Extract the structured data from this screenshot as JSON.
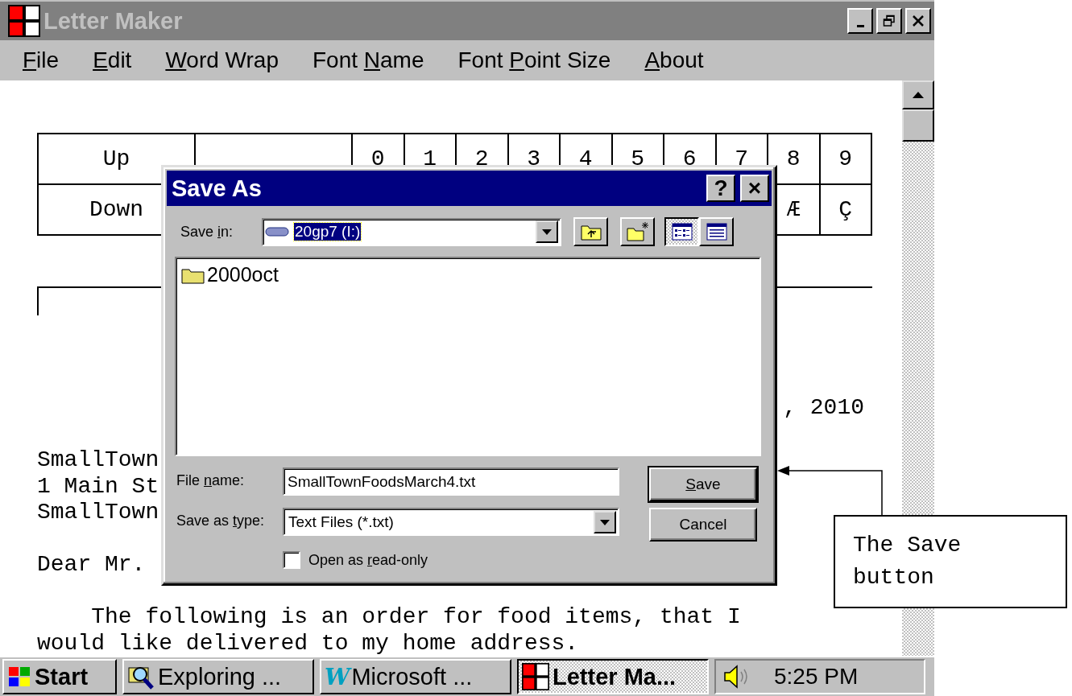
{
  "window": {
    "title": "Letter Maker",
    "active": false
  },
  "menu": [
    {
      "key": "F",
      "post": "ile"
    },
    {
      "key": "E",
      "post": "dit"
    },
    {
      "key": "W",
      "post": "ord Wrap"
    },
    {
      "pre": "Font ",
      "key": "N",
      "post": "ame"
    },
    {
      "pre": "Font ",
      "key": "P",
      "post": "oint Size"
    },
    {
      "key": "A",
      "post": "bout"
    }
  ],
  "keypad": {
    "rows": [
      {
        "label": "Up",
        "keys": [
          "0",
          "1",
          "2",
          "3",
          "4",
          "5",
          "6",
          "7",
          "8",
          "9"
        ]
      },
      {
        "label": "Down",
        "keys": [
          "Æ",
          "Ç"
        ]
      }
    ]
  },
  "letter": {
    "date": ", 2010",
    "address": [
      "SmallTown",
      "1 Main St",
      "SmallTown"
    ],
    "salutation": "Dear Mr.",
    "body": [
      "The following is an order for food items, that I",
      "would like delivered to my home address."
    ]
  },
  "dialog": {
    "title": "Save As",
    "title_buttons": [
      "?",
      "×"
    ],
    "save_in": {
      "label": {
        "pre": "Save ",
        "key": "i",
        "post": "n:"
      },
      "value": "20gp7 (I:)"
    },
    "views": [
      {
        "kind": "list",
        "selected": true
      },
      {
        "kind": "details",
        "selected": false
      }
    ],
    "files": [
      {
        "name": "2000oct",
        "kind": "folder"
      }
    ],
    "file_name": {
      "label": {
        "pre": "File ",
        "key": "n",
        "post": "ame:"
      },
      "value": "SmallTownFoodsMarch4.txt"
    },
    "save_as_type": {
      "label": {
        "pre": "Save as ",
        "key": "t",
        "post": "ype:"
      },
      "value": "Text Files (*.txt)"
    },
    "read_only": {
      "label": {
        "pre": "Open as ",
        "key": "r",
        "post": "ead-only"
      },
      "checked": false
    },
    "buttons": [
      {
        "label": {
          "key": "S",
          "post": "ave"
        },
        "default": true
      },
      {
        "label": {
          "pre": "Cancel"
        },
        "default": false
      }
    ]
  },
  "callout": {
    "text": "The Save button"
  },
  "taskbar": {
    "start": "Start",
    "tasks": [
      {
        "label": "Exploring ...",
        "kind": "explorer",
        "selected": false
      },
      {
        "label": "Microsoft ...",
        "kind": "word",
        "icon_text": "W",
        "selected": false
      },
      {
        "label": "Letter Ma...",
        "kind": "app",
        "selected": true
      }
    ],
    "clock": "5:25 PM"
  }
}
